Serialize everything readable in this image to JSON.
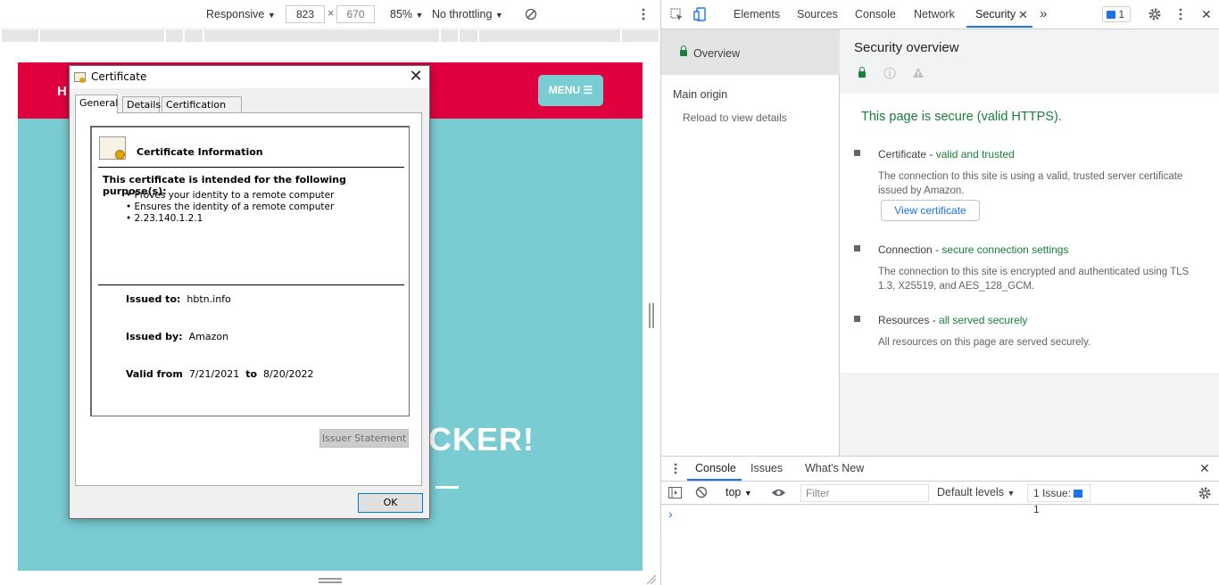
{
  "device_toolbar": {
    "device": "Responsive",
    "width": "823",
    "times": "×",
    "height": "670",
    "zoom": "85%",
    "throttling": "No throttling",
    "dropdown_glyph": "▼"
  },
  "site": {
    "header_letter": "H",
    "menu_label": "MENU ☰",
    "hero_text": "CKER!"
  },
  "dialog": {
    "title": "Certificate",
    "tabs": [
      "General",
      "Details",
      "Certification Path"
    ],
    "info_title": "Certificate Information",
    "purpose_heading": "This certificate is intended for the following purpose(s):",
    "purposes": [
      "Proves your identity to a remote computer",
      "Ensures the identity of a remote computer",
      "2.23.140.1.2.1"
    ],
    "bullet": "•",
    "issued_to_label": "Issued to:",
    "issued_to": "hbtn.info",
    "issued_by_label": "Issued by:",
    "issued_by": "Amazon",
    "valid_from_label": "Valid from",
    "valid_from": "7/21/2021",
    "to_label": "to",
    "valid_to": "8/20/2022",
    "issuer_statement": "Issuer Statement",
    "ok": "OK"
  },
  "devtools": {
    "tabs": [
      "Elements",
      "Sources",
      "Console",
      "Network",
      "Security"
    ],
    "more": "»",
    "issues_count": "1",
    "sidebar": {
      "overview": "Overview",
      "main_origin": "Main origin",
      "reload": "Reload to view details"
    },
    "security": {
      "heading": "Security overview",
      "secure_summary": "This page is secure (valid HTTPS).",
      "items": [
        {
          "label": "Certificate",
          "status": "valid and trusted",
          "desc": "The connection to this site is using a valid, trusted server certificate issued by Amazon."
        },
        {
          "label": "Connection",
          "status": "secure connection settings",
          "desc": "The connection to this site is encrypted and authenticated using TLS 1.3, X25519, and AES_128_GCM."
        },
        {
          "label": "Resources",
          "status": "all served securely",
          "desc": "All resources on this page are served securely."
        }
      ],
      "separator": " - ",
      "view_certificate": "View certificate"
    },
    "drawer": {
      "tabs": [
        "Console",
        "Issues",
        "What's New"
      ],
      "context": "top",
      "filter_placeholder": "Filter",
      "levels": "Default levels",
      "issue_label": "1 Issue:",
      "issue_count": "1",
      "prompt": "›"
    }
  }
}
